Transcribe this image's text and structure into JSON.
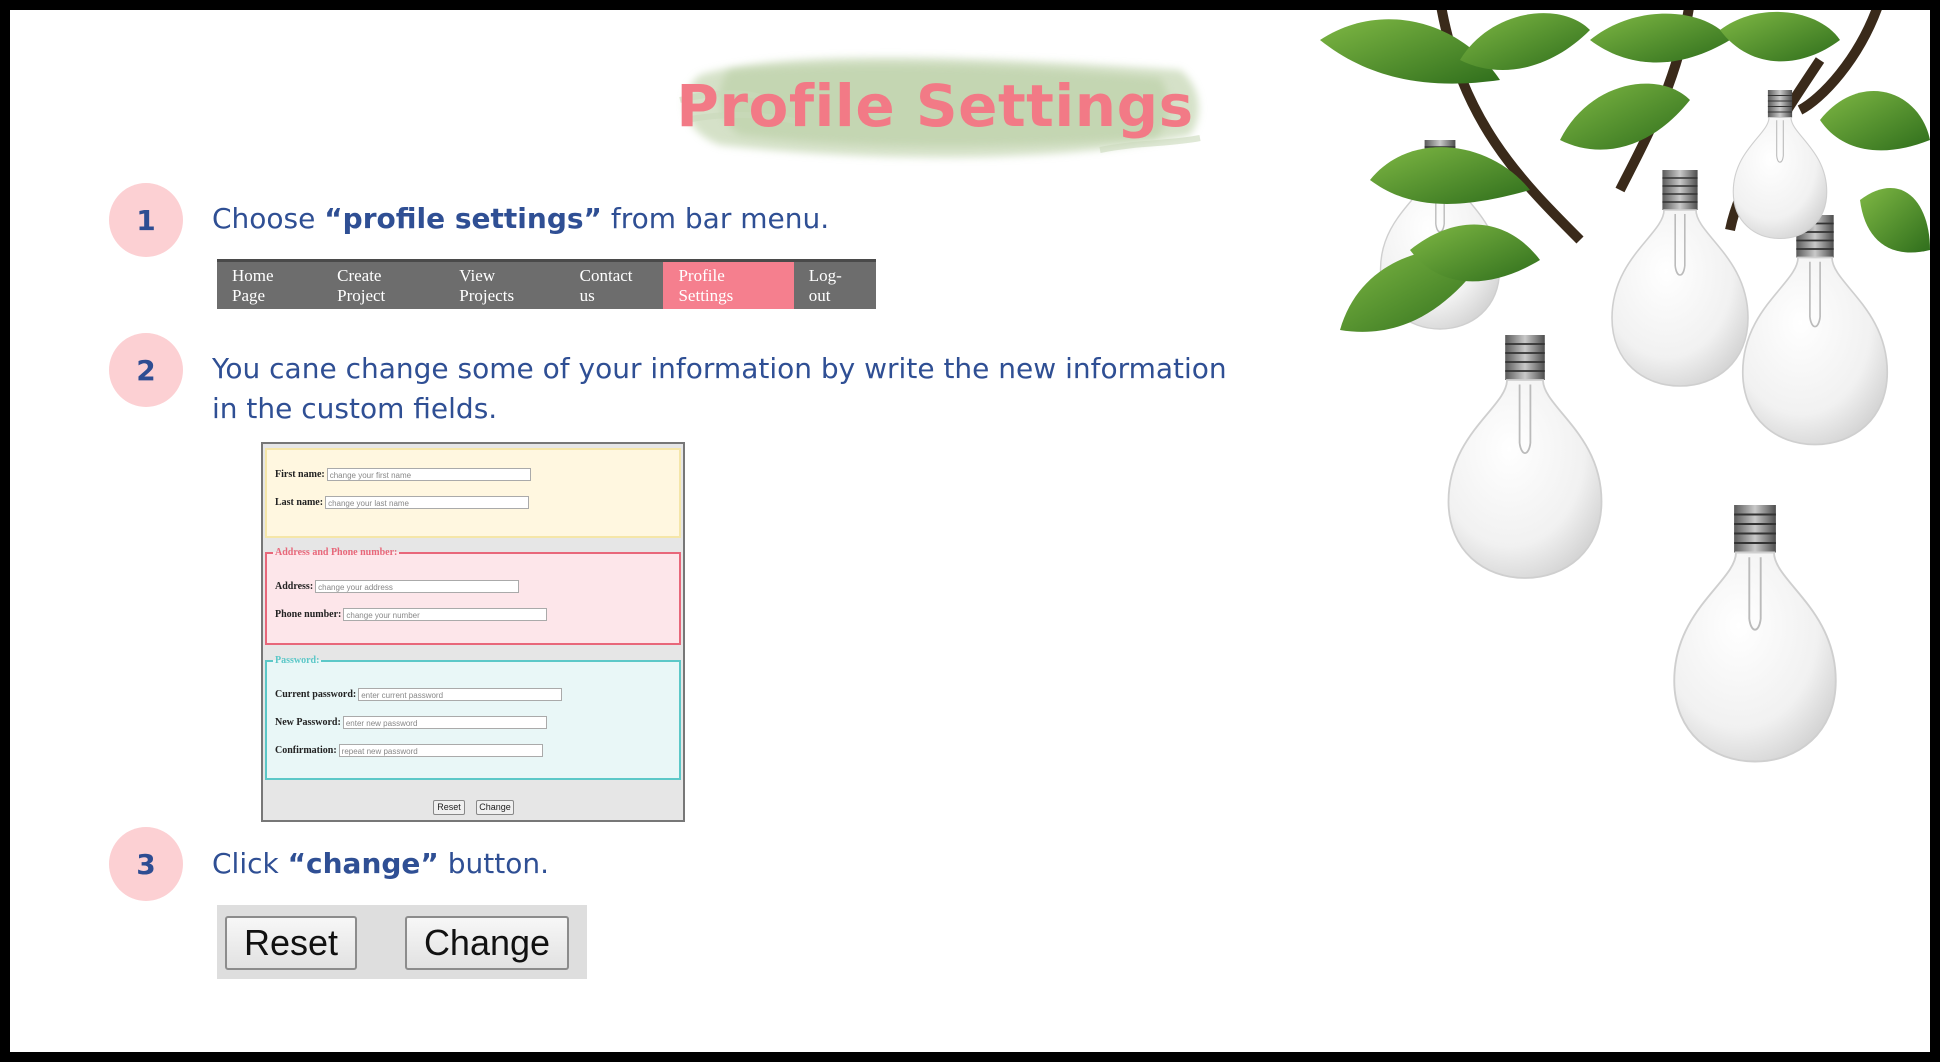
{
  "title": "Profile Settings",
  "steps": [
    {
      "number": "1",
      "pre": "Choose ",
      "bold": "“profile settings”",
      "post": " from bar menu."
    },
    {
      "number": "2",
      "line1": "You cane change some of your information by write the new information",
      "line2": "in the custom fields."
    },
    {
      "number": "3",
      "pre": "Click ",
      "bold": "“change”",
      "post": " button."
    }
  ],
  "menu": {
    "items": [
      "Home Page",
      "Create Project",
      "View Projects",
      "Contact us",
      "Profile Settings",
      "Log-out"
    ],
    "active": "Profile Settings"
  },
  "form": {
    "name_fields": [
      {
        "label": "First name:",
        "placeholder": "change your first name"
      },
      {
        "label": "Last name:",
        "placeholder": "change your last name"
      }
    ],
    "address_legend": "Address and Phone number:",
    "address_fields": [
      {
        "label": "Address:",
        "placeholder": "change your address"
      },
      {
        "label": "Phone number:",
        "placeholder": "change your number"
      }
    ],
    "password_legend": "Password:",
    "password_fields": [
      {
        "label": "Current password:",
        "placeholder": "enter current password"
      },
      {
        "label": "New Password:",
        "placeholder": "enter new password"
      },
      {
        "label": "Confirmation:",
        "placeholder": "repeat new password"
      }
    ],
    "reset_label": "Reset",
    "change_label": "Change"
  },
  "buttons": {
    "reset_label": "Reset",
    "change_label": "Change"
  },
  "colors": {
    "title": "#f27a86",
    "step_text": "#2f4f94",
    "badge": "#fcd0d3",
    "menu_bg": "#6d6d6d",
    "menu_active": "#f57f8e",
    "name_fieldset": "#f5e6a8",
    "address_fieldset": "#e8677a",
    "password_fieldset": "#5cc8c8"
  },
  "decor": {
    "illustration": "lightbulbs-with-leaves-image",
    "brush": "green-watercolor-brush-stroke"
  }
}
